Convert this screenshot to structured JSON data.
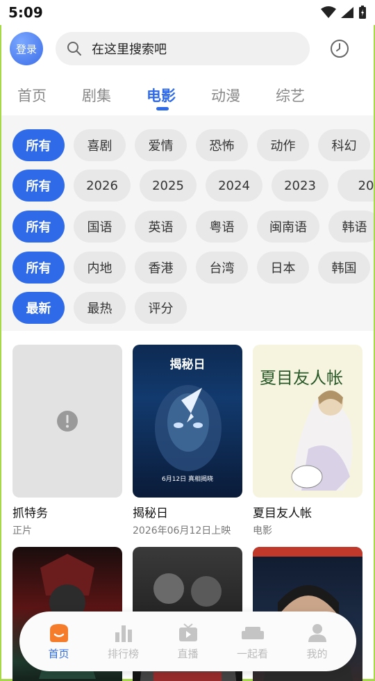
{
  "status_bar": {
    "time": "5:09"
  },
  "header": {
    "login_label": "登录",
    "search_placeholder": "在这里搜索吧"
  },
  "tabs": [
    {
      "label": "首页"
    },
    {
      "label": "剧集"
    },
    {
      "label": "电影",
      "active": true
    },
    {
      "label": "动漫"
    },
    {
      "label": "综艺"
    }
  ],
  "filters": {
    "genre": [
      "所有",
      "喜剧",
      "爱情",
      "恐怖",
      "动作",
      "科幻"
    ],
    "year": [
      "所有",
      "2026",
      "2025",
      "2024",
      "2023",
      "20"
    ],
    "language": [
      "所有",
      "国语",
      "英语",
      "粤语",
      "闽南语",
      "韩语"
    ],
    "region": [
      "所有",
      "内地",
      "香港",
      "台湾",
      "日本",
      "韩国"
    ],
    "sort": [
      "最新",
      "最热",
      "评分"
    ]
  },
  "movies": [
    {
      "title": "抓特务",
      "subtitle": "正片"
    },
    {
      "title": "揭秘日",
      "subtitle": "2026年06月12日上映",
      "poster_text": "揭秘日",
      "poster_caption": "6月12日 真相揭晓"
    },
    {
      "title": "夏目友人帐",
      "subtitle": "电影",
      "poster_text": "夏目友人帐"
    },
    {
      "title": "",
      "subtitle": ""
    },
    {
      "title": "",
      "subtitle": ""
    },
    {
      "title": "",
      "subtitle": ""
    }
  ],
  "bottom_nav": [
    {
      "label": "首页",
      "icon": "home-icon",
      "active": true
    },
    {
      "label": "排行榜",
      "icon": "ranking-icon"
    },
    {
      "label": "直播",
      "icon": "live-tv-icon"
    },
    {
      "label": "一起看",
      "icon": "sofa-icon"
    },
    {
      "label": "我的",
      "icon": "user-icon"
    }
  ],
  "colors": {
    "accent": "#2f6be8",
    "nav_active": "#f57c2b",
    "chip_bg": "#e8e8e8",
    "edge": "#a7d84a"
  }
}
